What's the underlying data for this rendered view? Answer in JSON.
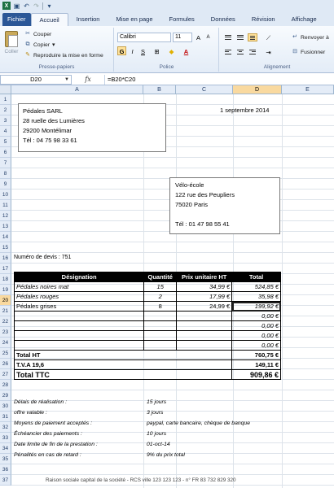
{
  "ribbon": {
    "tabs": [
      "Fichier",
      "Accueil",
      "Insertion",
      "Mise en page",
      "Formules",
      "Données",
      "Révision",
      "Affichage"
    ],
    "active_tab": "Accueil",
    "paste_label": "Coller",
    "cut_label": "Couper",
    "copy_label": "Copier",
    "format_painter_label": "Reproduire la mise en forme",
    "clipboard_group": "Presse-papiers",
    "font_name": "Calibri",
    "font_size": "11",
    "bold": "G",
    "italic": "I",
    "underline": "S",
    "font_group": "Police",
    "wrap_text": "Renvoyer à",
    "merge_label": "Fusionner",
    "alignment_group": "Alignement"
  },
  "formula_bar": {
    "cell_ref": "D20",
    "fx": "fx",
    "formula": "=B20*C20"
  },
  "grid": {
    "columns": [
      "A",
      "B",
      "C",
      "D",
      "E"
    ],
    "selected_column": "D",
    "rows": [
      "1",
      "2",
      "3",
      "4",
      "5",
      "6",
      "7",
      "8",
      "9",
      "10",
      "11",
      "12",
      "13",
      "14",
      "15",
      "16",
      "17",
      "18",
      "19",
      "20",
      "21",
      "22",
      "23",
      "24",
      "25",
      "26",
      "27",
      "28",
      "29",
      "30",
      "31",
      "32",
      "33",
      "34",
      "35",
      "36",
      "37"
    ],
    "selected_row": "20"
  },
  "sheet": {
    "sender": [
      "Pédales SARL",
      "28 ruelle des Lumières",
      "29200  Montélimar",
      "Tél : 04 75 98 33 61"
    ],
    "date": "1 septembre 2014",
    "recipient": [
      "Vélo-école",
      "122 rue des Peupliers",
      "75020  Paris",
      "",
      "Tél : 01 47 98 55 41"
    ],
    "quote_number": "Numéro de devis : 751",
    "table_headers": [
      "Désignation",
      "Quantité",
      "Prix unitaire HT",
      "Total"
    ],
    "items": [
      {
        "designation": "Pédales noires mat",
        "qty": "15",
        "unit": "34,99 €",
        "total": "524,85 €",
        "italic": true
      },
      {
        "designation": "Pédales rouges",
        "qty": "2",
        "unit": "17,99 €",
        "total": "35,98 €",
        "italic": true
      },
      {
        "designation": "Pédales grises",
        "qty": "8",
        "unit": "24,99 €",
        "total": "199,92 €",
        "italic": false
      },
      {
        "designation": "",
        "qty": "",
        "unit": "",
        "total": "0,00 €",
        "italic": false
      },
      {
        "designation": "",
        "qty": "",
        "unit": "",
        "total": "0,00 €",
        "italic": false
      },
      {
        "designation": "",
        "qty": "",
        "unit": "",
        "total": "0,00 €",
        "italic": false
      },
      {
        "designation": "",
        "qty": "",
        "unit": "",
        "total": "0,00 €",
        "italic": false
      }
    ],
    "total_ht_label": "Total HT",
    "total_ht": "760,75 €",
    "tva_label": "T.V.A 19,6",
    "tva": "149,11 €",
    "total_ttc_label": "Total TTC",
    "total_ttc": "909,86 €",
    "conditions": [
      {
        "label": "Délais de réalisation :",
        "value": "15 jours"
      },
      {
        "label": "offre valable :",
        "value": "3 jours"
      },
      {
        "label": "Moyens de paiement acceptés :",
        "value": "paypal, carte bancaire, chèque de banque"
      },
      {
        "label": "Échéancier des paiements :",
        "value": "10 jours"
      },
      {
        "label": "Date limite de fin de la prestation :",
        "value": "01-oct-14"
      },
      {
        "label": "Pénalités en cas de retard :",
        "value": "9% du prix total"
      }
    ],
    "footer": "Raison sociale  capital de la société - RCS  ville 123 123 123 - n° FR 83  732 829 320"
  },
  "colors": {
    "file_tab": "#2b5797",
    "selection_header": "#f9d99f",
    "table_header_bg": "#000000"
  }
}
